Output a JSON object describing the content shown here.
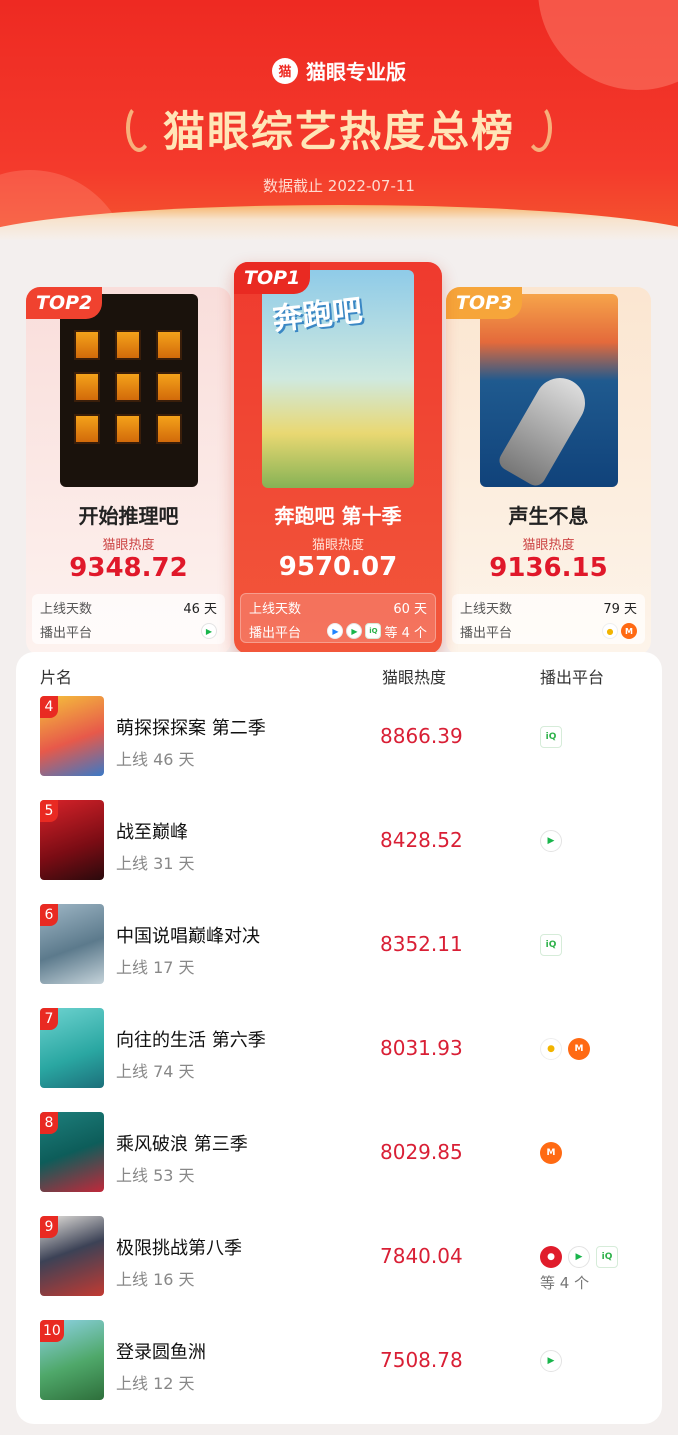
{
  "header": {
    "brand": "猫眼专业版",
    "logo_glyph": "猫",
    "title": "猫眼综艺热度总榜",
    "date": "数据截止 2022-07-11"
  },
  "top3": [
    {
      "rank": "TOP1",
      "title": "奔跑吧 第十季",
      "heat_label": "猫眼热度",
      "heat": "9570.07",
      "days_label": "上线天数",
      "days": "60 天",
      "platform_label": "播出平台",
      "platforms": [
        "youku-icon",
        "tencent-video-icon",
        "iqiyi-icon"
      ],
      "platform_more": "等 4 个",
      "poster_text": "奔跑吧"
    },
    {
      "rank": "TOP2",
      "title": "开始推理吧",
      "heat_label": "猫眼热度",
      "heat": "9348.72",
      "days_label": "上线天数",
      "days": "46 天",
      "platform_label": "播出平台",
      "platforms": [
        "tencent-video-icon"
      ]
    },
    {
      "rank": "TOP3",
      "title": "声生不息",
      "heat_label": "猫眼热度",
      "heat": "9136.15",
      "days_label": "上线天数",
      "days": "79 天",
      "platform_label": "播出平台",
      "platforms": [
        "hunan-tv-icon",
        "mango-tv-icon"
      ]
    }
  ],
  "list": {
    "headers": {
      "name": "片名",
      "heat": "猫眼热度",
      "platform": "播出平台"
    },
    "rows": [
      {
        "rank": "4",
        "title": "萌探探探案 第二季",
        "days": "上线 46 天",
        "heat": "8866.39",
        "platforms": [
          "iqiyi-icon"
        ],
        "more": ""
      },
      {
        "rank": "5",
        "title": "战至巅峰",
        "days": "上线 31 天",
        "heat": "8428.52",
        "platforms": [
          "tencent-video-icon"
        ],
        "more": ""
      },
      {
        "rank": "6",
        "title": "中国说唱巅峰对决",
        "days": "上线 17 天",
        "heat": "8352.11",
        "platforms": [
          "iqiyi-icon"
        ],
        "more": ""
      },
      {
        "rank": "7",
        "title": "向往的生活 第六季",
        "days": "上线 74 天",
        "heat": "8031.93",
        "platforms": [
          "hunan-tv-icon",
          "mango-tv-icon"
        ],
        "more": ""
      },
      {
        "rank": "8",
        "title": "乘风破浪 第三季",
        "days": "上线 53 天",
        "heat": "8029.85",
        "platforms": [
          "mango-tv-icon"
        ],
        "more": ""
      },
      {
        "rank": "9",
        "title": "极限挑战第八季",
        "days": "上线 16 天",
        "heat": "7840.04",
        "platforms": [
          "cctv-icon",
          "tencent-video-icon",
          "iqiyi-icon"
        ],
        "more": "等 4 个"
      },
      {
        "rank": "10",
        "title": "登录圆鱼洲",
        "days": "上线 12 天",
        "heat": "7508.78",
        "platforms": [
          "tencent-video-icon"
        ],
        "more": ""
      }
    ]
  },
  "colors": {
    "brand_red": "#ee2a22",
    "heat_red": "#d91f35",
    "gold": "#ffe6b8"
  }
}
